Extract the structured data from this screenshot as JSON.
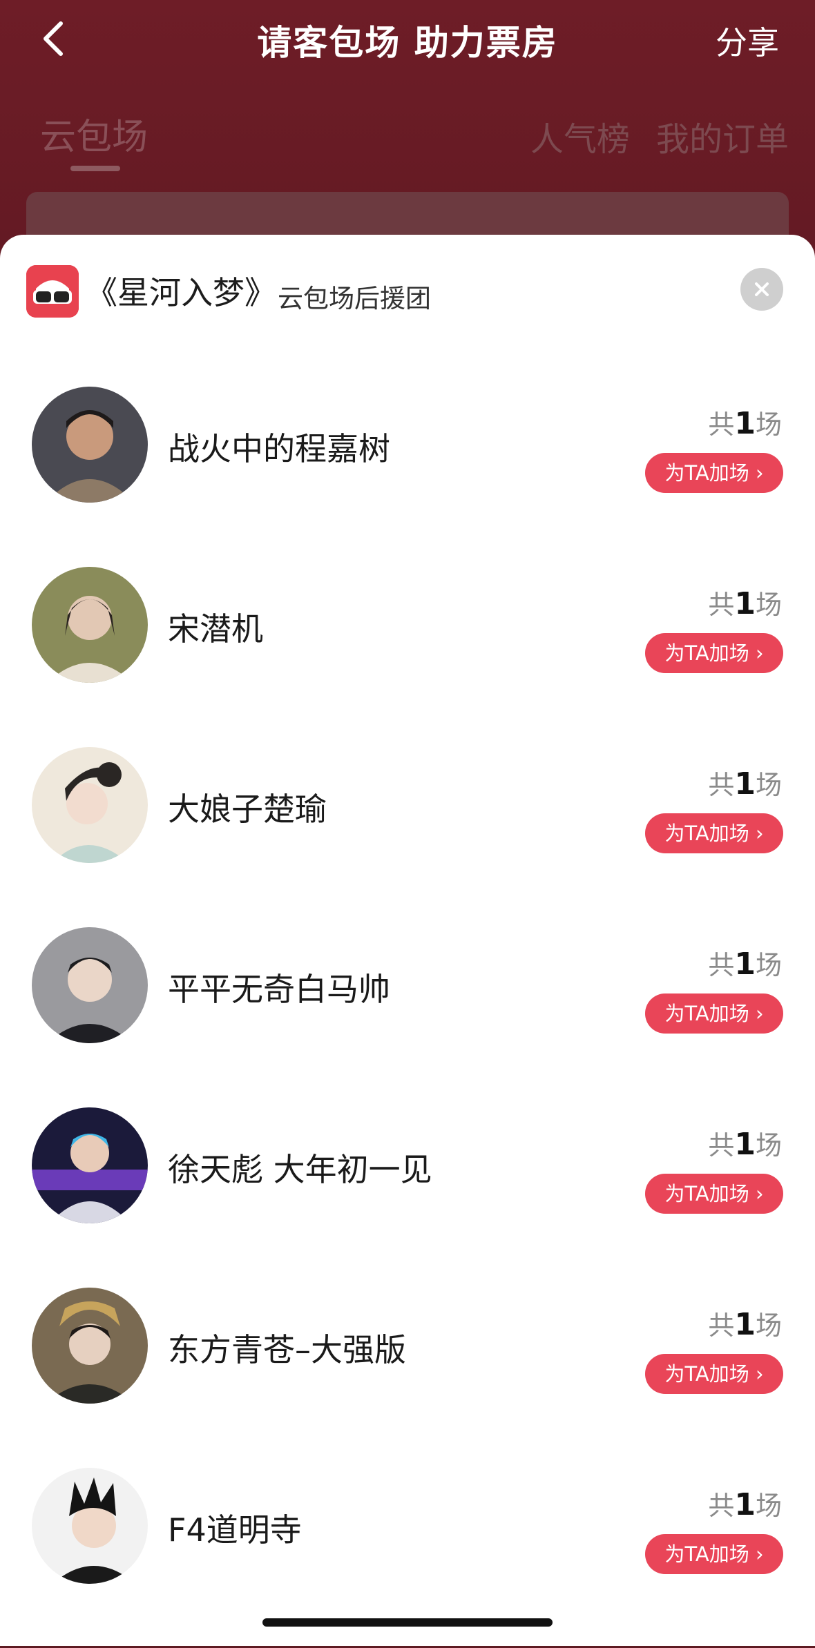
{
  "header": {
    "title": "请客包场 助力票房",
    "share_label": "分享"
  },
  "tabs": {
    "left": "云包场",
    "right": [
      "人气榜",
      "我的订单"
    ]
  },
  "sheet": {
    "title": "《星河入梦》",
    "subtitle": "云包场后援团"
  },
  "list": [
    {
      "name": "战火中的程嘉树",
      "count_prefix": "共",
      "count": "1",
      "count_suffix": "场",
      "button": "为TA加场 ›"
    },
    {
      "name": "宋潜机",
      "count_prefix": "共",
      "count": "1",
      "count_suffix": "场",
      "button": "为TA加场 ›"
    },
    {
      "name": "大娘子楚瑜",
      "count_prefix": "共",
      "count": "1",
      "count_suffix": "场",
      "button": "为TA加场 ›"
    },
    {
      "name": "平平无奇白马帅",
      "count_prefix": "共",
      "count": "1",
      "count_suffix": "场",
      "button": "为TA加场 ›"
    },
    {
      "name": "徐天彪 大年初一见",
      "count_prefix": "共",
      "count": "1",
      "count_suffix": "场",
      "button": "为TA加场 ›"
    },
    {
      "name": "东方青苍–大强版",
      "count_prefix": "共",
      "count": "1",
      "count_suffix": "场",
      "button": "为TA加场 ›"
    },
    {
      "name": "F4道明寺",
      "count_prefix": "共",
      "count": "1",
      "count_suffix": "场",
      "button": "为TA加场 ›"
    }
  ],
  "colors": {
    "accent": "#e94558",
    "background_top": "#6e1d27"
  },
  "icons": {
    "back": "chevron-left-icon",
    "close": "close-icon",
    "logo": "3d-glasses-logo"
  }
}
